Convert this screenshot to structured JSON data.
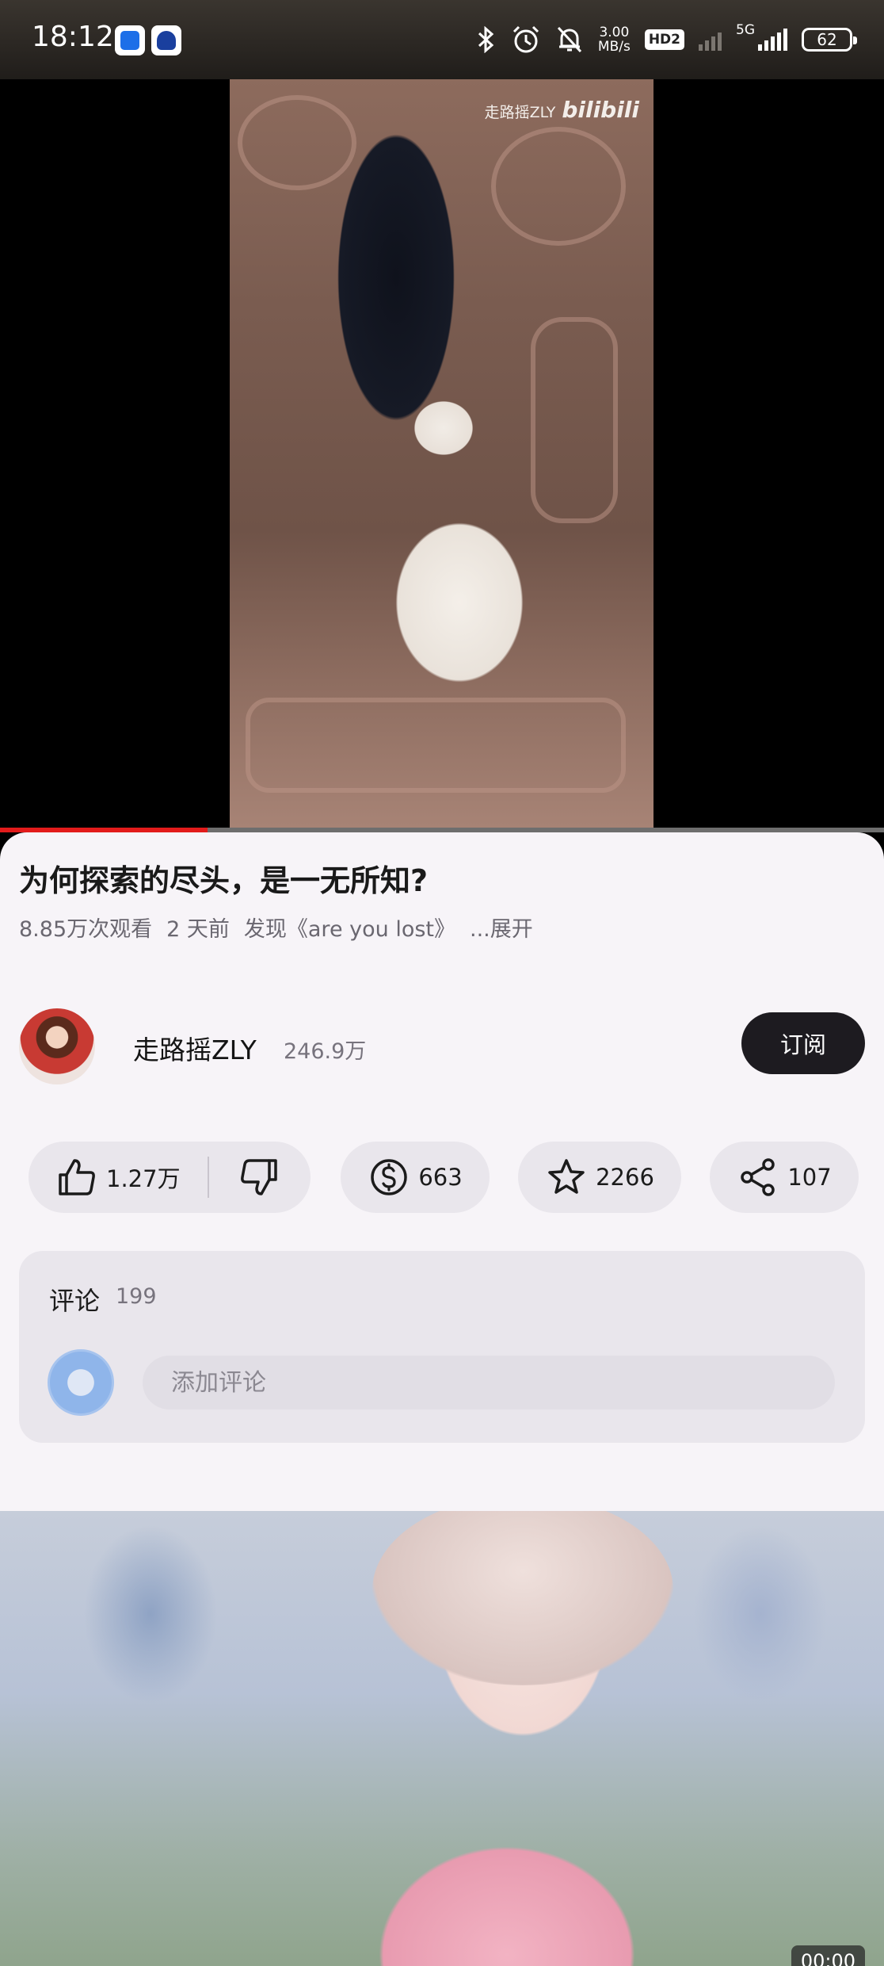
{
  "status_bar": {
    "time": "18:12",
    "net_speed_value": "3.00",
    "net_speed_unit": "MB/s",
    "hd_badge": "HD2",
    "network": "5G",
    "battery": "62",
    "icons": [
      "bluetooth-icon",
      "alarm-icon",
      "mute-bell-icon"
    ]
  },
  "video": {
    "watermark_author": "走路摇ZLY",
    "watermark_brand": "bilibili",
    "progress_fraction": 0.235
  },
  "details": {
    "title": "为何探索的尽头，是一无所知?",
    "views": "8.85万次观看",
    "age": "2 天前",
    "tag": "发现《are you lost》",
    "expand_label": "...展开"
  },
  "channel": {
    "name": "走路摇ZLY",
    "subscribers": "246.9万",
    "subscribe_label": "订阅"
  },
  "actions": {
    "likes": "1.27万",
    "coins": "663",
    "favorites": "2266",
    "shares": "107"
  },
  "comments": {
    "label": "评论",
    "count": "199",
    "placeholder": "添加评论"
  },
  "next_video": {
    "duration": "00:00"
  },
  "colors": {
    "accent": "#e21b1b",
    "subscribe_bg": "#1d1b20",
    "sheet_bg": "#f7f4f8",
    "pill_bg": "#e9e6ec"
  }
}
